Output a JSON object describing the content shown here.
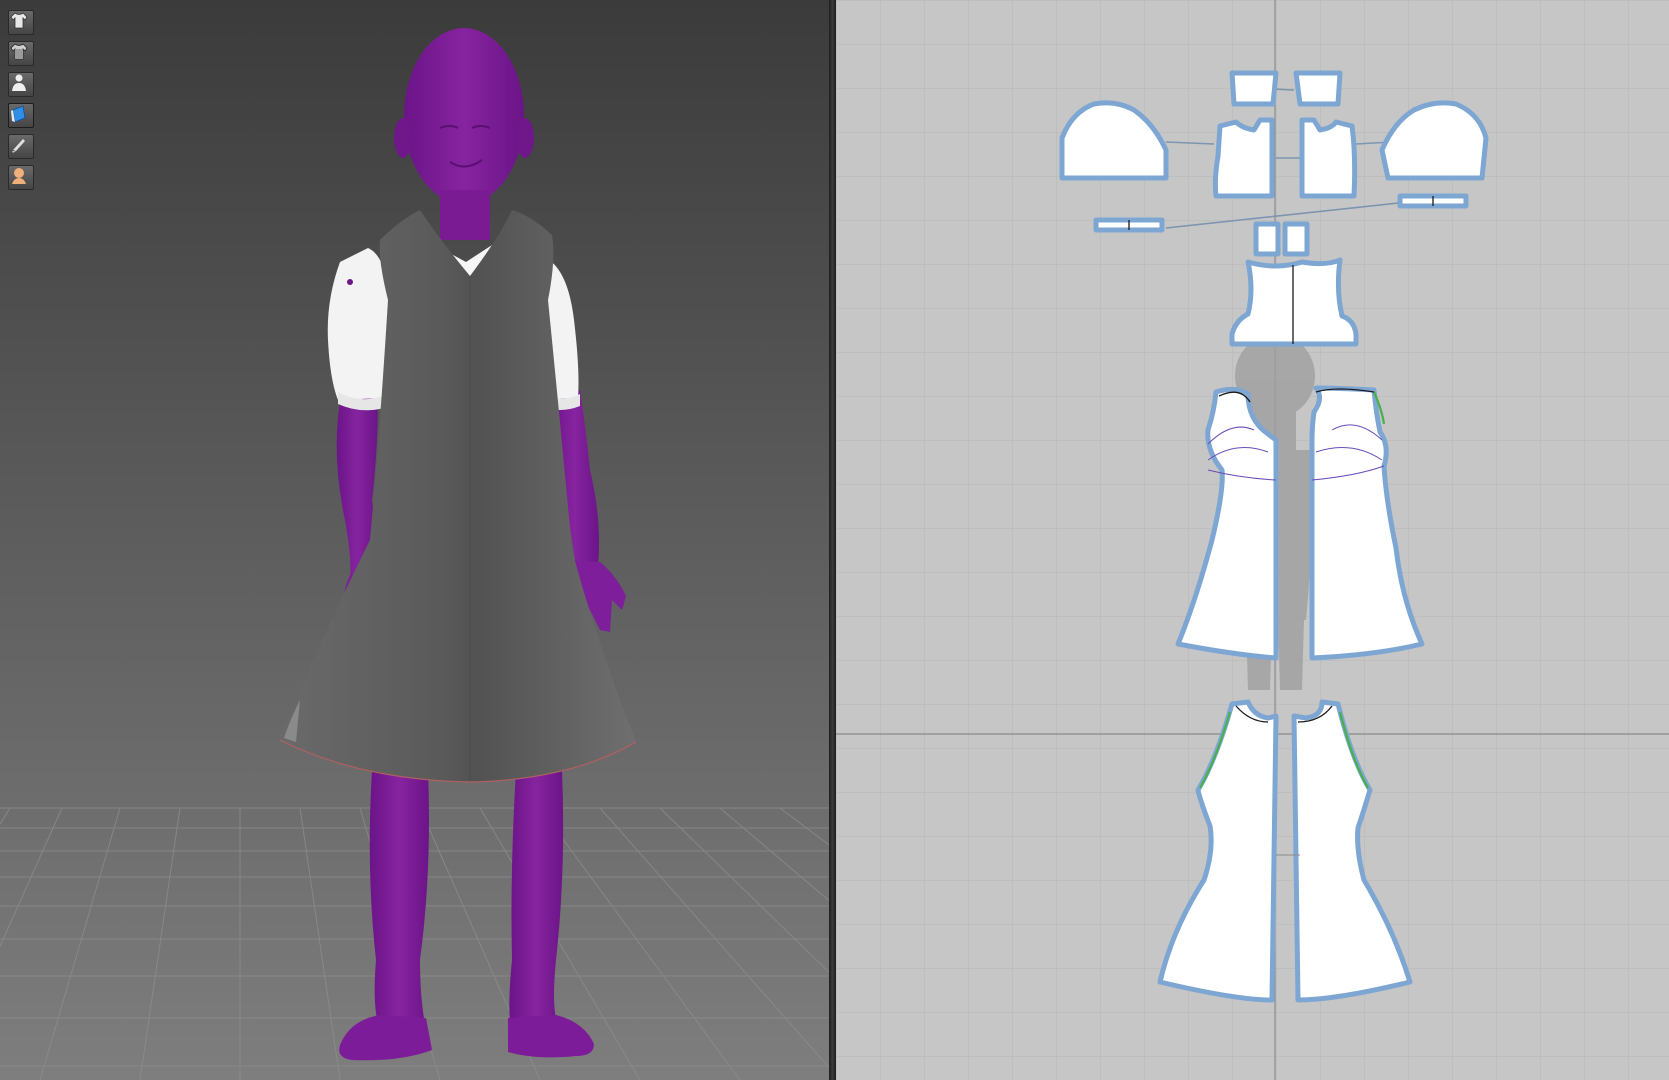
{
  "app": {
    "panes": [
      "3d-viewport",
      "2d-pattern-window"
    ]
  },
  "toolbar": {
    "buttons": [
      {
        "icon": "garment-shirt-icon",
        "state": "normal"
      },
      {
        "icon": "garment-shirt-solid-icon",
        "state": "normal"
      },
      {
        "icon": "avatar-figure-icon",
        "state": "normal"
      },
      {
        "icon": "texture-mode-icon",
        "state": "active"
      },
      {
        "icon": "brush-icon",
        "state": "normal"
      },
      {
        "icon": "avatar-head-icon",
        "state": "normal"
      }
    ]
  },
  "colors": {
    "avatar": "#7a1f96",
    "dress": "#5e5e5e",
    "shirt": "#f4f4f4",
    "piece_fill": "#ffffff",
    "piece_outline": "#7ea6d3",
    "grid_bg": "#c6c6c6",
    "seam_green": "#48b04a"
  },
  "pattern_pieces": [
    "collar-stand-left",
    "collar-stand-right",
    "sleeve-left",
    "sleeve-right",
    "shirt-front-left",
    "shirt-front-right",
    "cuff-left",
    "cuff-right",
    "collar-left",
    "collar-right",
    "shirt-back",
    "dress-front-left",
    "dress-front-right",
    "dress-back-left",
    "dress-back-right"
  ]
}
